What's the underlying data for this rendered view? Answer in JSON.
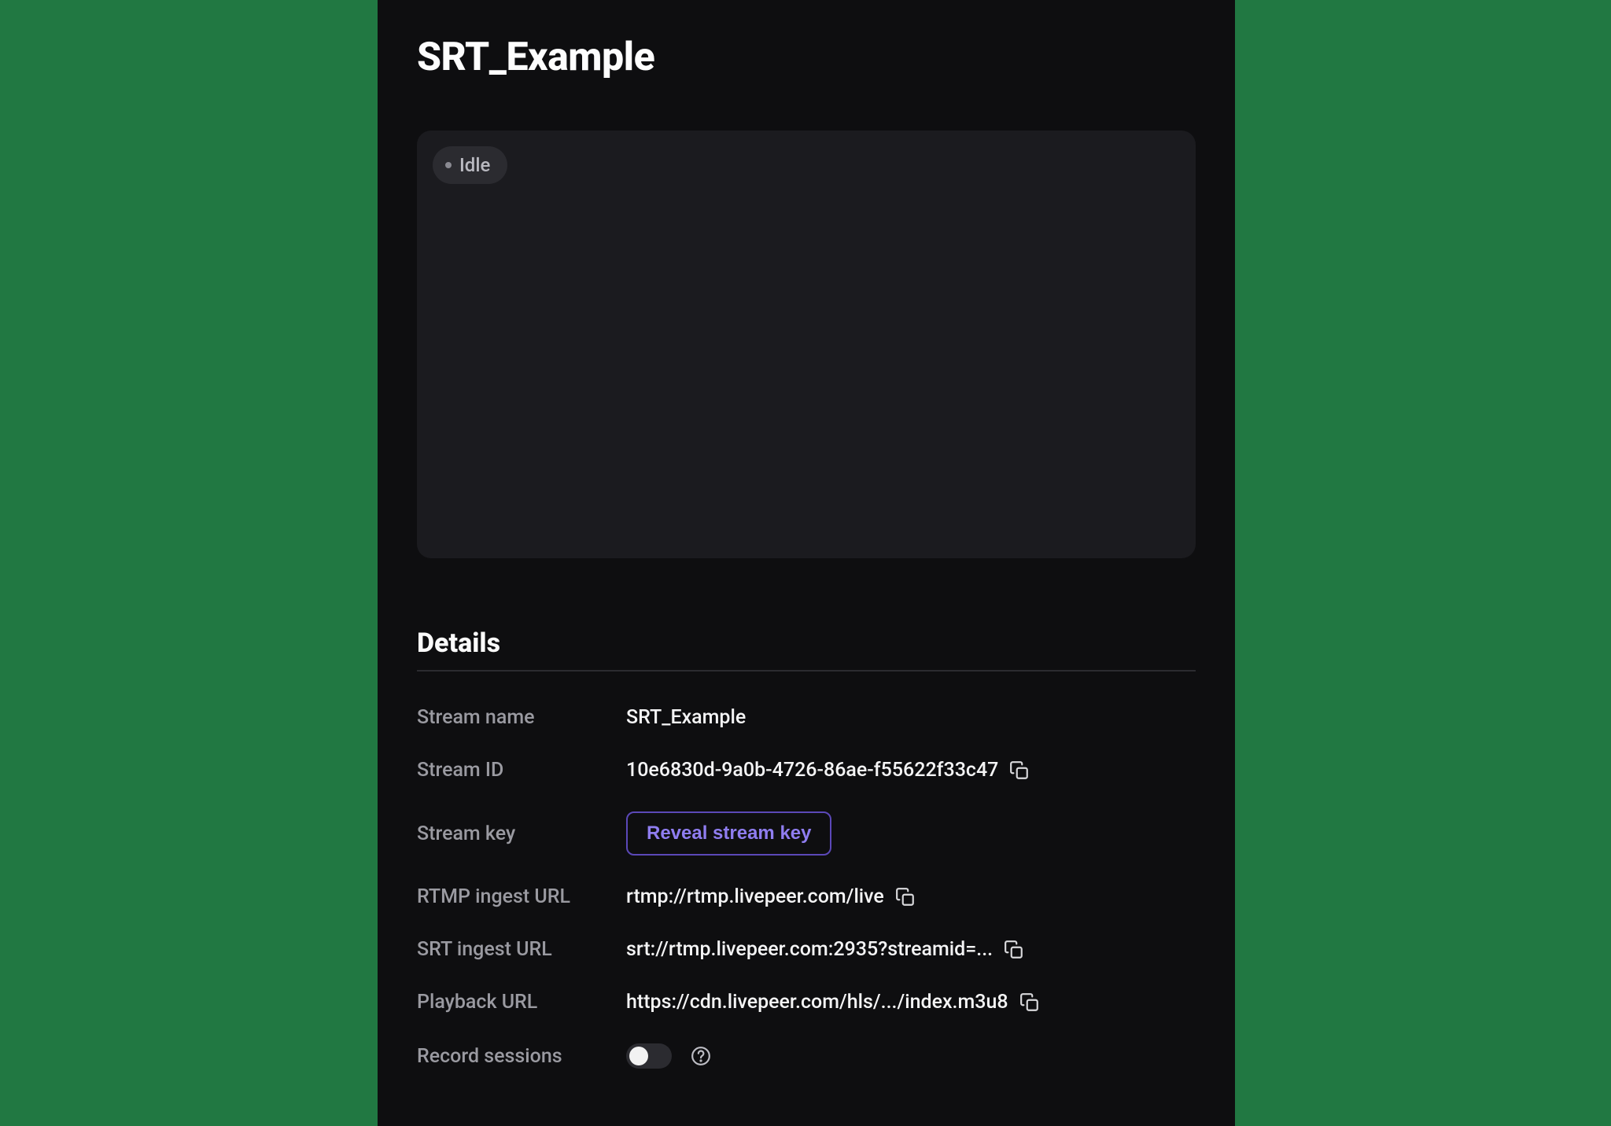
{
  "page": {
    "title": "SRT_Example"
  },
  "status": {
    "label": "Idle"
  },
  "details": {
    "heading": "Details",
    "labels": {
      "stream_name": "Stream name",
      "stream_id": "Stream ID",
      "stream_key": "Stream key",
      "rtmp_ingest_url": "RTMP ingest URL",
      "srt_ingest_url": "SRT ingest URL",
      "playback_url": "Playback URL",
      "record_sessions": "Record sessions"
    },
    "values": {
      "stream_name": "SRT_Example",
      "stream_id": "10e6830d-9a0b-4726-86ae-f55622f33c47",
      "rtmp_ingest_url": "rtmp://rtmp.livepeer.com/live",
      "srt_ingest_url": "srt://rtmp.livepeer.com:2935?streamid=...",
      "playback_url": "https://cdn.livepeer.com/hls/.../index.m3u8",
      "record_sessions_on": false
    },
    "reveal_button": "Reveal stream key"
  },
  "colors": {
    "accent": "#8f7df0",
    "accent_border": "#5b48b8",
    "panel_bg": "#0e0e10",
    "preview_bg": "#1b1b1f",
    "page_bg": "#217842"
  }
}
